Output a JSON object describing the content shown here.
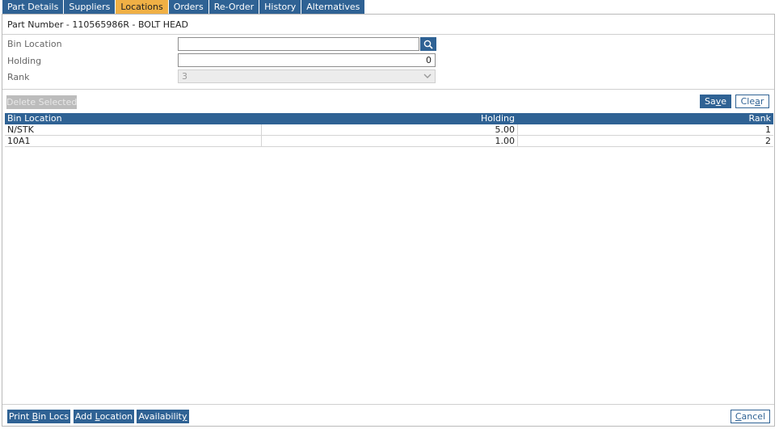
{
  "tabs": [
    {
      "label": "Part Details",
      "active": false
    },
    {
      "label": "Suppliers",
      "active": false
    },
    {
      "label": "Locations",
      "active": true
    },
    {
      "label": "Orders",
      "active": false
    },
    {
      "label": "Re-Order",
      "active": false
    },
    {
      "label": "History",
      "active": false
    },
    {
      "label": "Alternatives",
      "active": false
    }
  ],
  "header": {
    "part_number": "Part Number - 110565986R - BOLT HEAD"
  },
  "form": {
    "bin_location": {
      "label": "Bin Location",
      "value": ""
    },
    "holding": {
      "label": "Holding",
      "value": "0"
    },
    "rank": {
      "label": "Rank",
      "value": "3"
    }
  },
  "toolbar": {
    "delete_label": "Delete Selected",
    "save_pre": "Sa",
    "save_ul": "v",
    "save_post": "e",
    "clear_pre": "Cle",
    "clear_ul": "a",
    "clear_post": "r"
  },
  "grid": {
    "columns": [
      "Bin Location",
      "Holding",
      "Rank"
    ],
    "rows": [
      [
        "N/STK",
        "5.00",
        "1"
      ],
      [
        "10A1",
        "1.00",
        "2"
      ]
    ]
  },
  "footer": {
    "print_pre": "Print ",
    "print_ul": "B",
    "print_post": "in Locs",
    "add_pre": "Add ",
    "add_ul": "L",
    "add_post": "ocation",
    "avail_pre": "Availabilit",
    "avail_ul": "y",
    "avail_post": "",
    "cancel_pre": "",
    "cancel_ul": "C",
    "cancel_post": "ancel"
  },
  "colors": {
    "accent": "#2f6294",
    "active_tab": "#f0b045",
    "disabled": "#bcbcbc"
  },
  "icons": {
    "search": "search-icon",
    "dropdown": "chevron-down-icon"
  }
}
